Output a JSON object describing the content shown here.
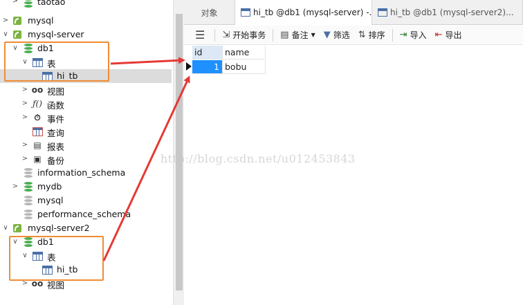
{
  "tree": {
    "items": [
      {
        "label": "taotao",
        "icon": "database-green-icon"
      },
      {
        "label": "mysql",
        "icon": "database-gray-icon"
      },
      {
        "label": "mysql-server",
        "icon": "mysql-connection-icon"
      },
      {
        "label": "db1",
        "icon": "database-green-icon"
      },
      {
        "label": "表",
        "icon": "table-icon"
      },
      {
        "label": "hi_tb",
        "icon": "table-icon"
      },
      {
        "label": "视图",
        "icon": "view-icon"
      },
      {
        "label": "函数",
        "icon": "function-icon"
      },
      {
        "label": "事件",
        "icon": "event-icon"
      },
      {
        "label": "查询",
        "icon": "query-icon"
      },
      {
        "label": "报表",
        "icon": "report-icon"
      },
      {
        "label": "备份",
        "icon": "backup-icon"
      },
      {
        "label": "information_schema",
        "icon": "database-gray-icon"
      },
      {
        "label": "mydb",
        "icon": "database-green-icon"
      },
      {
        "label": "mysql",
        "icon": "database-gray-icon"
      },
      {
        "label": "performance_schema",
        "icon": "database-gray-icon"
      },
      {
        "label": "mysql-server2",
        "icon": "mysql-connection-icon"
      },
      {
        "label": "db1",
        "icon": "database-green-icon"
      },
      {
        "label": "表",
        "icon": "table-icon"
      },
      {
        "label": "hi_tb",
        "icon": "table-icon"
      },
      {
        "label": "视图",
        "icon": "view-icon"
      }
    ]
  },
  "tabs": [
    {
      "label": "对象"
    },
    {
      "label": "hi_tb @db1 (mysql-server) -..."
    },
    {
      "label": "hi_tb @db1 (mysql-server2)..."
    }
  ],
  "toolbar": {
    "begin_tx": "开始事务",
    "memo": "备注",
    "filter": "筛选",
    "sort": "排序",
    "import": "导入",
    "export": "导出"
  },
  "grid": {
    "columns": [
      "id",
      "name"
    ],
    "rows": [
      [
        "1",
        "bobu"
      ]
    ]
  },
  "watermark": "http://blog.csdn.net/u012453843",
  "colors": {
    "highlight_box": "#f08c32",
    "arrow": "#e53935",
    "selection": "#1e90ff",
    "db_green": "#4caf50"
  }
}
